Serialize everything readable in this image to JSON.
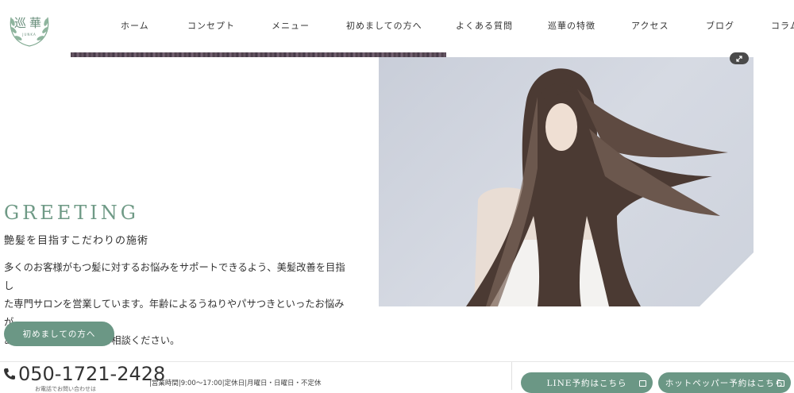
{
  "logo": {
    "text": "巡華",
    "subtext": "JUNKA"
  },
  "nav": {
    "items": [
      {
        "label": "ホーム"
      },
      {
        "label": "コンセプト"
      },
      {
        "label": "メニュー"
      },
      {
        "label": "初めましての方へ"
      },
      {
        "label": "よくある質問"
      },
      {
        "label": "巡華の特徴"
      },
      {
        "label": "アクセス"
      },
      {
        "label": "ブログ"
      },
      {
        "label": "コラム"
      }
    ]
  },
  "greeting": {
    "title": "GREETING",
    "subtitle": "艶髪を目指すこだわりの施術",
    "body_lines": [
      "多くのお客様がもつ髪に対するお悩みをサポートできるよう、美髪改善を目指し",
      "た専門サロンを営業しています。年齢によるうねりやパサつきといったお悩みが",
      "ある方は、ご遠慮なくご相談ください。"
    ],
    "button_label": "初めましての方へ"
  },
  "footer_bar": {
    "phone": "050-1721-2428",
    "hours": "|営業時間|9:00〜17:00|定休日|月曜日・日曜日・不定休",
    "note": "お電話でお問い合わせは",
    "line_button": "LINE予約はこちら",
    "hotpepper_button": "ホットペッパー予約はこちら"
  },
  "colors": {
    "accent": "#6b9785",
    "title": "#6f9a86"
  },
  "icons": {
    "phone": "phone-icon",
    "expand": "expand-icon",
    "external": "external-link-icon"
  }
}
